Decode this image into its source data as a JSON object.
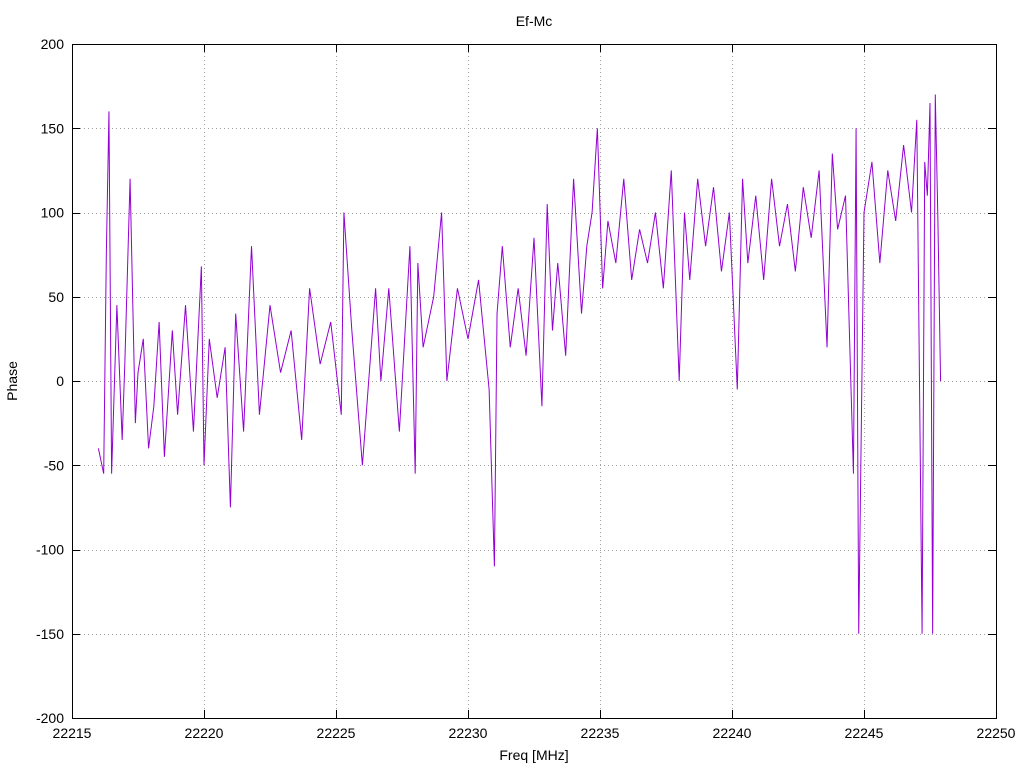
{
  "chart_data": {
    "type": "line",
    "title": "Ef-Mc",
    "xlabel": "Freq [MHz]",
    "ylabel": "Phase",
    "xlim": [
      22215,
      22250
    ],
    "ylim": [
      -200,
      200
    ],
    "xticks": [
      22215,
      22220,
      22225,
      22230,
      22235,
      22240,
      22245,
      22250
    ],
    "yticks": [
      -200,
      -150,
      -100,
      -50,
      0,
      50,
      100,
      150,
      200
    ],
    "grid": true,
    "legend": "none",
    "series": [
      {
        "color": "#9400d3",
        "x": [
          22216.0,
          22216.2,
          22216.3,
          22216.4,
          22216.5,
          22216.7,
          22216.9,
          22217.0,
          22217.2,
          22217.4,
          22217.5,
          22217.7,
          22217.9,
          22218.1,
          22218.3,
          22218.5,
          22218.8,
          22219.0,
          22219.3,
          22219.6,
          22219.9,
          22220.0,
          22220.2,
          22220.5,
          22220.8,
          22221.0,
          22221.2,
          22221.5,
          22221.8,
          22222.1,
          22222.5,
          22222.9,
          22223.3,
          22223.7,
          22224.0,
          22224.4,
          22224.8,
          22225.2,
          22225.3,
          22225.6,
          22226.0,
          22226.5,
          22226.7,
          22227.0,
          22227.4,
          22227.8,
          22228.0,
          22228.1,
          22228.3,
          22228.7,
          22229.0,
          22229.2,
          22229.6,
          22230.0,
          22230.4,
          22230.8,
          22231.0,
          22231.1,
          22231.3,
          22231.6,
          22231.9,
          22232.2,
          22232.5,
          22232.8,
          22233.0,
          22233.2,
          22233.4,
          22233.7,
          22234.0,
          22234.3,
          22234.5,
          22234.7,
          22234.9,
          22235.1,
          22235.3,
          22235.6,
          22235.9,
          22236.2,
          22236.5,
          22236.8,
          22237.1,
          22237.4,
          22237.7,
          22238.0,
          22238.2,
          22238.4,
          22238.7,
          22239.0,
          22239.3,
          22239.6,
          22239.9,
          22240.2,
          22240.4,
          22240.6,
          22240.9,
          22241.2,
          22241.5,
          22241.8,
          22242.1,
          22242.4,
          22242.7,
          22243.0,
          22243.3,
          22243.6,
          22243.8,
          22244.0,
          22244.3,
          22244.6,
          22244.7,
          22244.8,
          22245.0,
          22245.3,
          22245.6,
          22245.9,
          22246.2,
          22246.5,
          22246.8,
          22247.0,
          22247.2,
          22247.3,
          22247.4,
          22247.5,
          22247.6,
          22247.7,
          22247.8,
          22247.9
        ],
        "y": [
          -40,
          -55,
          75,
          160,
          -55,
          45,
          -35,
          10,
          120,
          -25,
          5,
          25,
          -40,
          -15,
          35,
          -45,
          30,
          -20,
          45,
          -30,
          68,
          -50,
          25,
          -10,
          20,
          -75,
          40,
          -30,
          80,
          -20,
          45,
          5,
          30,
          -35,
          55,
          10,
          35,
          -20,
          100,
          30,
          -50,
          55,
          0,
          55,
          -30,
          80,
          -55,
          70,
          20,
          50,
          100,
          0,
          55,
          25,
          60,
          -5,
          -110,
          40,
          80,
          20,
          55,
          15,
          85,
          -15,
          105,
          30,
          70,
          15,
          120,
          40,
          80,
          100,
          150,
          55,
          95,
          70,
          120,
          60,
          90,
          70,
          100,
          55,
          125,
          0,
          100,
          60,
          120,
          80,
          115,
          65,
          100,
          -5,
          120,
          70,
          110,
          60,
          120,
          80,
          105,
          65,
          115,
          85,
          125,
          20,
          135,
          90,
          110,
          -55,
          150,
          -150,
          100,
          130,
          70,
          125,
          95,
          140,
          100,
          155,
          -150,
          130,
          110,
          165,
          -150,
          170,
          95,
          0
        ]
      }
    ]
  }
}
